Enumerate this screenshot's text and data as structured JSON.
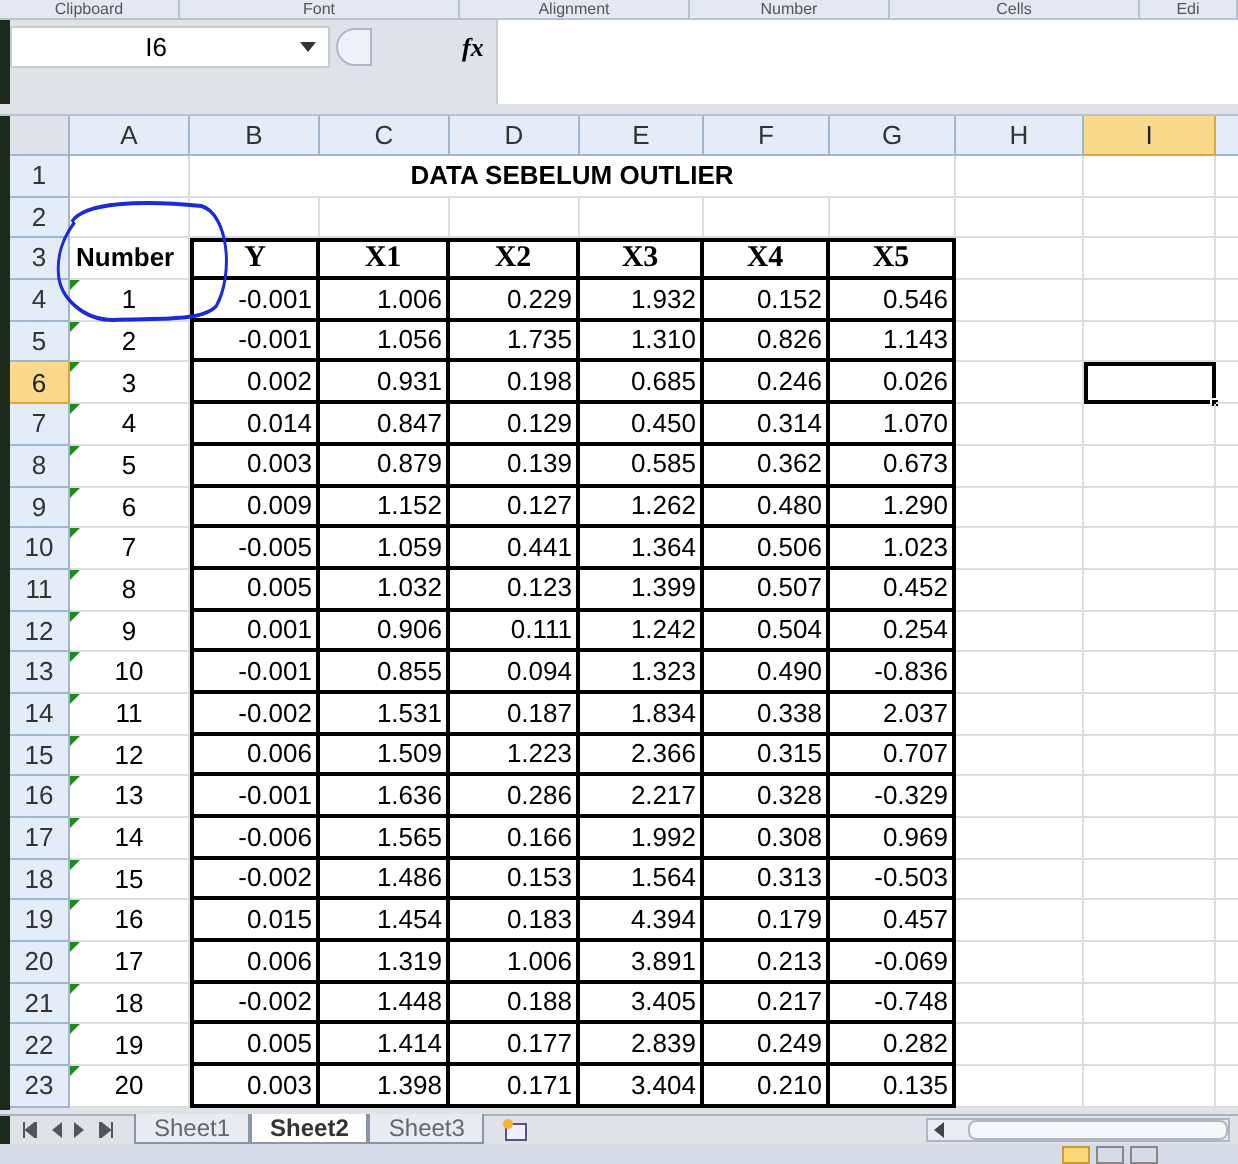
{
  "ribbon_groups": [
    "Clipboard",
    "Font",
    "Alignment",
    "Number",
    "Cells",
    "Edi"
  ],
  "name_box": {
    "value": "I6"
  },
  "formula_bar": {
    "label": "fx"
  },
  "column_headers": [
    {
      "label": "A",
      "selected": false
    },
    {
      "label": "B",
      "selected": false
    },
    {
      "label": "C",
      "selected": false
    },
    {
      "label": "D",
      "selected": false
    },
    {
      "label": "E",
      "selected": false
    },
    {
      "label": "F",
      "selected": false
    },
    {
      "label": "G",
      "selected": false
    },
    {
      "label": "H",
      "selected": false
    },
    {
      "label": "I",
      "selected": true
    }
  ],
  "row_headers": [
    {
      "label": "1",
      "selected": false
    },
    {
      "label": "2",
      "selected": false
    },
    {
      "label": "3",
      "selected": false
    },
    {
      "label": "4",
      "selected": false
    },
    {
      "label": "5",
      "selected": false
    },
    {
      "label": "6",
      "selected": true
    },
    {
      "label": "7",
      "selected": false
    },
    {
      "label": "8",
      "selected": false
    },
    {
      "label": "9",
      "selected": false
    },
    {
      "label": "10",
      "selected": false
    },
    {
      "label": "11",
      "selected": false
    },
    {
      "label": "12",
      "selected": false
    },
    {
      "label": "13",
      "selected": false
    },
    {
      "label": "14",
      "selected": false
    },
    {
      "label": "15",
      "selected": false
    },
    {
      "label": "16",
      "selected": false
    },
    {
      "label": "17",
      "selected": false
    },
    {
      "label": "18",
      "selected": false
    },
    {
      "label": "19",
      "selected": false
    },
    {
      "label": "20",
      "selected": false
    },
    {
      "label": "21",
      "selected": false
    },
    {
      "label": "22",
      "selected": false
    },
    {
      "label": "23",
      "selected": false
    }
  ],
  "title": "DATA SEBELUM OUTLIER",
  "table": {
    "number_header": "Number",
    "columns": [
      "Y",
      "X1",
      "X2",
      "X3",
      "X4",
      "X5"
    ],
    "rows": [
      {
        "number": "1",
        "error_flag": true,
        "values": [
          "-0.001",
          "1.006",
          "0.229",
          "1.932",
          "0.152",
          "0.546"
        ]
      },
      {
        "number": "2",
        "error_flag": true,
        "values": [
          "-0.001",
          "1.056",
          "1.735",
          "1.310",
          "0.826",
          "1.143"
        ]
      },
      {
        "number": "3",
        "error_flag": true,
        "values": [
          "0.002",
          "0.931",
          "0.198",
          "0.685",
          "0.246",
          "0.026"
        ]
      },
      {
        "number": "4",
        "error_flag": true,
        "values": [
          "0.014",
          "0.847",
          "0.129",
          "0.450",
          "0.314",
          "1.070"
        ]
      },
      {
        "number": "5",
        "error_flag": true,
        "values": [
          "0.003",
          "0.879",
          "0.139",
          "0.585",
          "0.362",
          "0.673"
        ]
      },
      {
        "number": "6",
        "error_flag": true,
        "values": [
          "0.009",
          "1.152",
          "0.127",
          "1.262",
          "0.480",
          "1.290"
        ]
      },
      {
        "number": "7",
        "error_flag": true,
        "values": [
          "-0.005",
          "1.059",
          "0.441",
          "1.364",
          "0.506",
          "1.023"
        ]
      },
      {
        "number": "8",
        "error_flag": true,
        "values": [
          "0.005",
          "1.032",
          "0.123",
          "1.399",
          "0.507",
          "0.452"
        ]
      },
      {
        "number": "9",
        "error_flag": true,
        "values": [
          "0.001",
          "0.906",
          "0.111",
          "1.242",
          "0.504",
          "0.254"
        ]
      },
      {
        "number": "10",
        "error_flag": true,
        "values": [
          "-0.001",
          "0.855",
          "0.094",
          "1.323",
          "0.490",
          "-0.836"
        ]
      },
      {
        "number": "11",
        "error_flag": true,
        "values": [
          "-0.002",
          "1.531",
          "0.187",
          "1.834",
          "0.338",
          "2.037"
        ]
      },
      {
        "number": "12",
        "error_flag": true,
        "values": [
          "0.006",
          "1.509",
          "1.223",
          "2.366",
          "0.315",
          "0.707"
        ]
      },
      {
        "number": "13",
        "error_flag": true,
        "values": [
          "-0.001",
          "1.636",
          "0.286",
          "2.217",
          "0.328",
          "-0.329"
        ]
      },
      {
        "number": "14",
        "error_flag": true,
        "values": [
          "-0.006",
          "1.565",
          "0.166",
          "1.992",
          "0.308",
          "0.969"
        ]
      },
      {
        "number": "15",
        "error_flag": true,
        "values": [
          "-0.002",
          "1.486",
          "0.153",
          "1.564",
          "0.313",
          "-0.503"
        ]
      },
      {
        "number": "16",
        "error_flag": true,
        "values": [
          "0.015",
          "1.454",
          "0.183",
          "4.394",
          "0.179",
          "0.457"
        ]
      },
      {
        "number": "17",
        "error_flag": true,
        "values": [
          "0.006",
          "1.319",
          "1.006",
          "3.891",
          "0.213",
          "-0.069"
        ]
      },
      {
        "number": "18",
        "error_flag": true,
        "values": [
          "-0.002",
          "1.448",
          "0.188",
          "3.405",
          "0.217",
          "-0.748"
        ]
      },
      {
        "number": "19",
        "error_flag": true,
        "values": [
          "0.005",
          "1.414",
          "0.177",
          "2.839",
          "0.249",
          "0.282"
        ]
      },
      {
        "number": "20",
        "error_flag": true,
        "values": [
          "0.003",
          "1.398",
          "0.171",
          "3.404",
          "0.210",
          "0.135"
        ]
      }
    ]
  },
  "sheet_tabs": [
    {
      "label": "Sheet1",
      "selected": false
    },
    {
      "label": "Sheet2",
      "selected": true
    },
    {
      "label": "Sheet3",
      "selected": false
    }
  ]
}
